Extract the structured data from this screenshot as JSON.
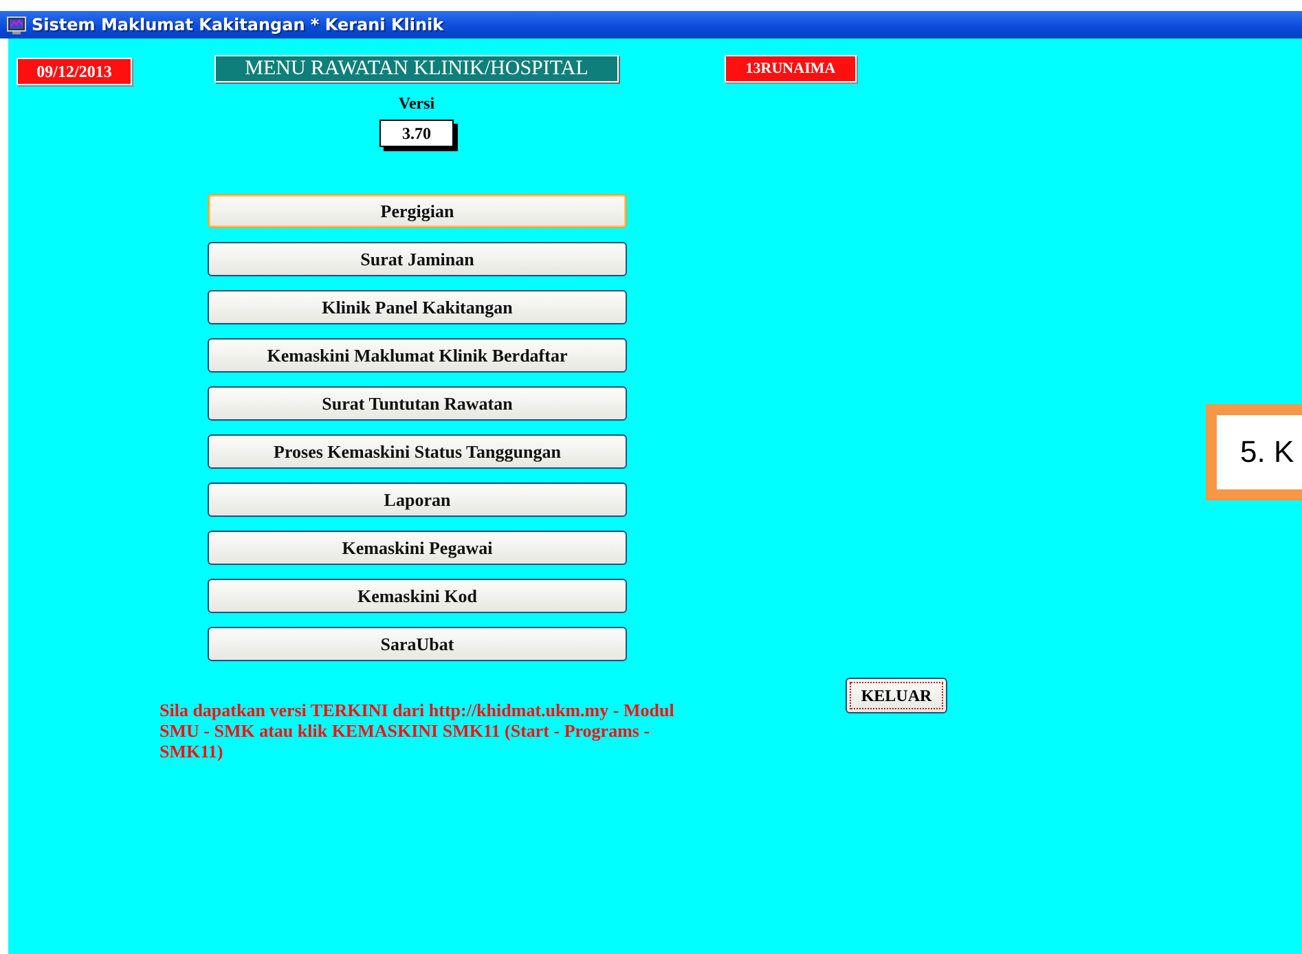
{
  "window": {
    "title": "Sistem Maklumat Kakitangan * Kerani Klinik"
  },
  "date": "09/12/2013",
  "heading": "MENU RAWATAN KLINIK/HOSPITAL",
  "user": "13RUNAIMA",
  "version": {
    "label": "Versi",
    "value": "3.70"
  },
  "menu": [
    {
      "label": "Pergigian",
      "selected": true
    },
    {
      "label": "Surat Jaminan",
      "selected": false
    },
    {
      "label": "Klinik Panel Kakitangan",
      "selected": false
    },
    {
      "label": "Kemaskini Maklumat Klinik Berdaftar",
      "selected": false
    },
    {
      "label": "Surat Tuntutan Rawatan",
      "selected": false
    },
    {
      "label": "Proses Kemaskini Status Tanggungan",
      "selected": false
    },
    {
      "label": "Laporan",
      "selected": false
    },
    {
      "label": "Kemaskini Pegawai",
      "selected": false
    },
    {
      "label": "Kemaskini Kod",
      "selected": false
    },
    {
      "label": "SaraUbat",
      "selected": false
    }
  ],
  "exit_button": "KELUAR",
  "notice": "Sila dapatkan versi TERKINI dari http://khidmat.ukm.my - Modul SMU - SMK atau klik KEMASKINI SMK11 (Start - Programs - SMK11)",
  "callout": "5. K"
}
